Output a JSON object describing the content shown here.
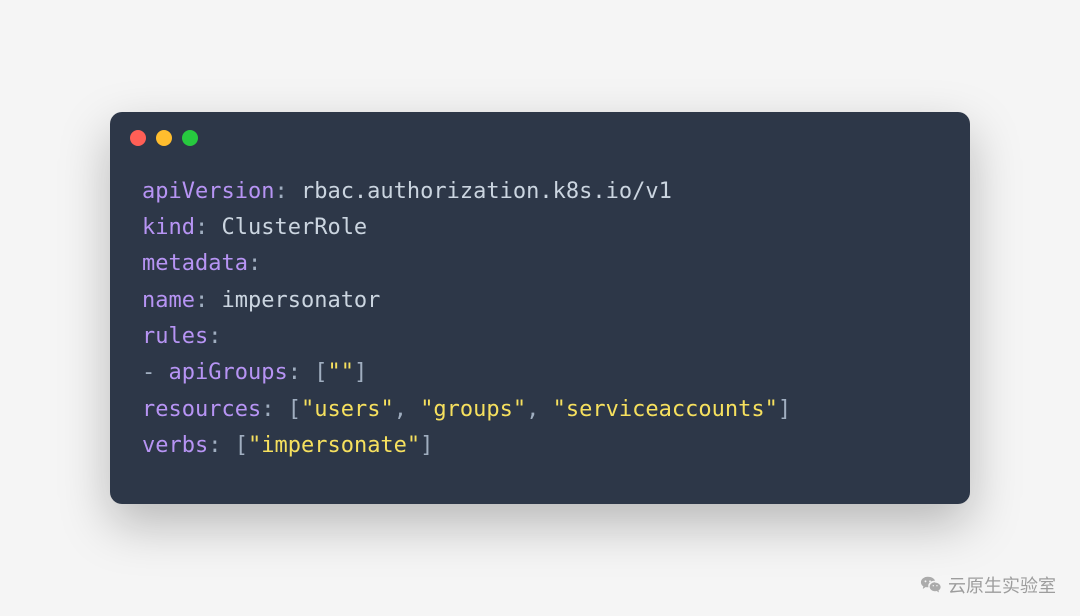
{
  "code": {
    "lines": [
      {
        "segments": [
          {
            "cls": "kw",
            "t": "apiVersion"
          },
          {
            "cls": "punct",
            "t": ": "
          },
          {
            "cls": "val",
            "t": "rbac.authorization.k8s.io/v1"
          }
        ]
      },
      {
        "segments": [
          {
            "cls": "kw",
            "t": "kind"
          },
          {
            "cls": "punct",
            "t": ": "
          },
          {
            "cls": "val",
            "t": "ClusterRole"
          }
        ]
      },
      {
        "segments": [
          {
            "cls": "kw",
            "t": "metadata"
          },
          {
            "cls": "punct",
            "t": ":"
          }
        ]
      },
      {
        "segments": [
          {
            "cls": "val",
            "t": "  "
          },
          {
            "cls": "kw",
            "t": "name"
          },
          {
            "cls": "punct",
            "t": ": "
          },
          {
            "cls": "val",
            "t": "impersonator"
          }
        ]
      },
      {
        "segments": [
          {
            "cls": "kw",
            "t": "rules"
          },
          {
            "cls": "punct",
            "t": ":"
          }
        ]
      },
      {
        "segments": [
          {
            "cls": "punct",
            "t": "- "
          },
          {
            "cls": "kw",
            "t": "apiGroups"
          },
          {
            "cls": "punct",
            "t": ": ["
          },
          {
            "cls": "str",
            "t": "\"\""
          },
          {
            "cls": "punct",
            "t": "]"
          }
        ]
      },
      {
        "segments": [
          {
            "cls": "val",
            "t": "  "
          },
          {
            "cls": "kw",
            "t": "resources"
          },
          {
            "cls": "punct",
            "t": ": ["
          },
          {
            "cls": "str",
            "t": "\"users\""
          },
          {
            "cls": "punct",
            "t": ", "
          },
          {
            "cls": "str",
            "t": "\"groups\""
          },
          {
            "cls": "punct",
            "t": ", "
          },
          {
            "cls": "str",
            "t": "\"serviceaccounts\""
          },
          {
            "cls": "punct",
            "t": "]"
          }
        ]
      },
      {
        "segments": [
          {
            "cls": "val",
            "t": "  "
          },
          {
            "cls": "kw",
            "t": "verbs"
          },
          {
            "cls": "punct",
            "t": ": ["
          },
          {
            "cls": "str",
            "t": "\"impersonate\""
          },
          {
            "cls": "punct",
            "t": "]"
          }
        ]
      }
    ]
  },
  "watermark": {
    "text": "云原生实验室"
  }
}
